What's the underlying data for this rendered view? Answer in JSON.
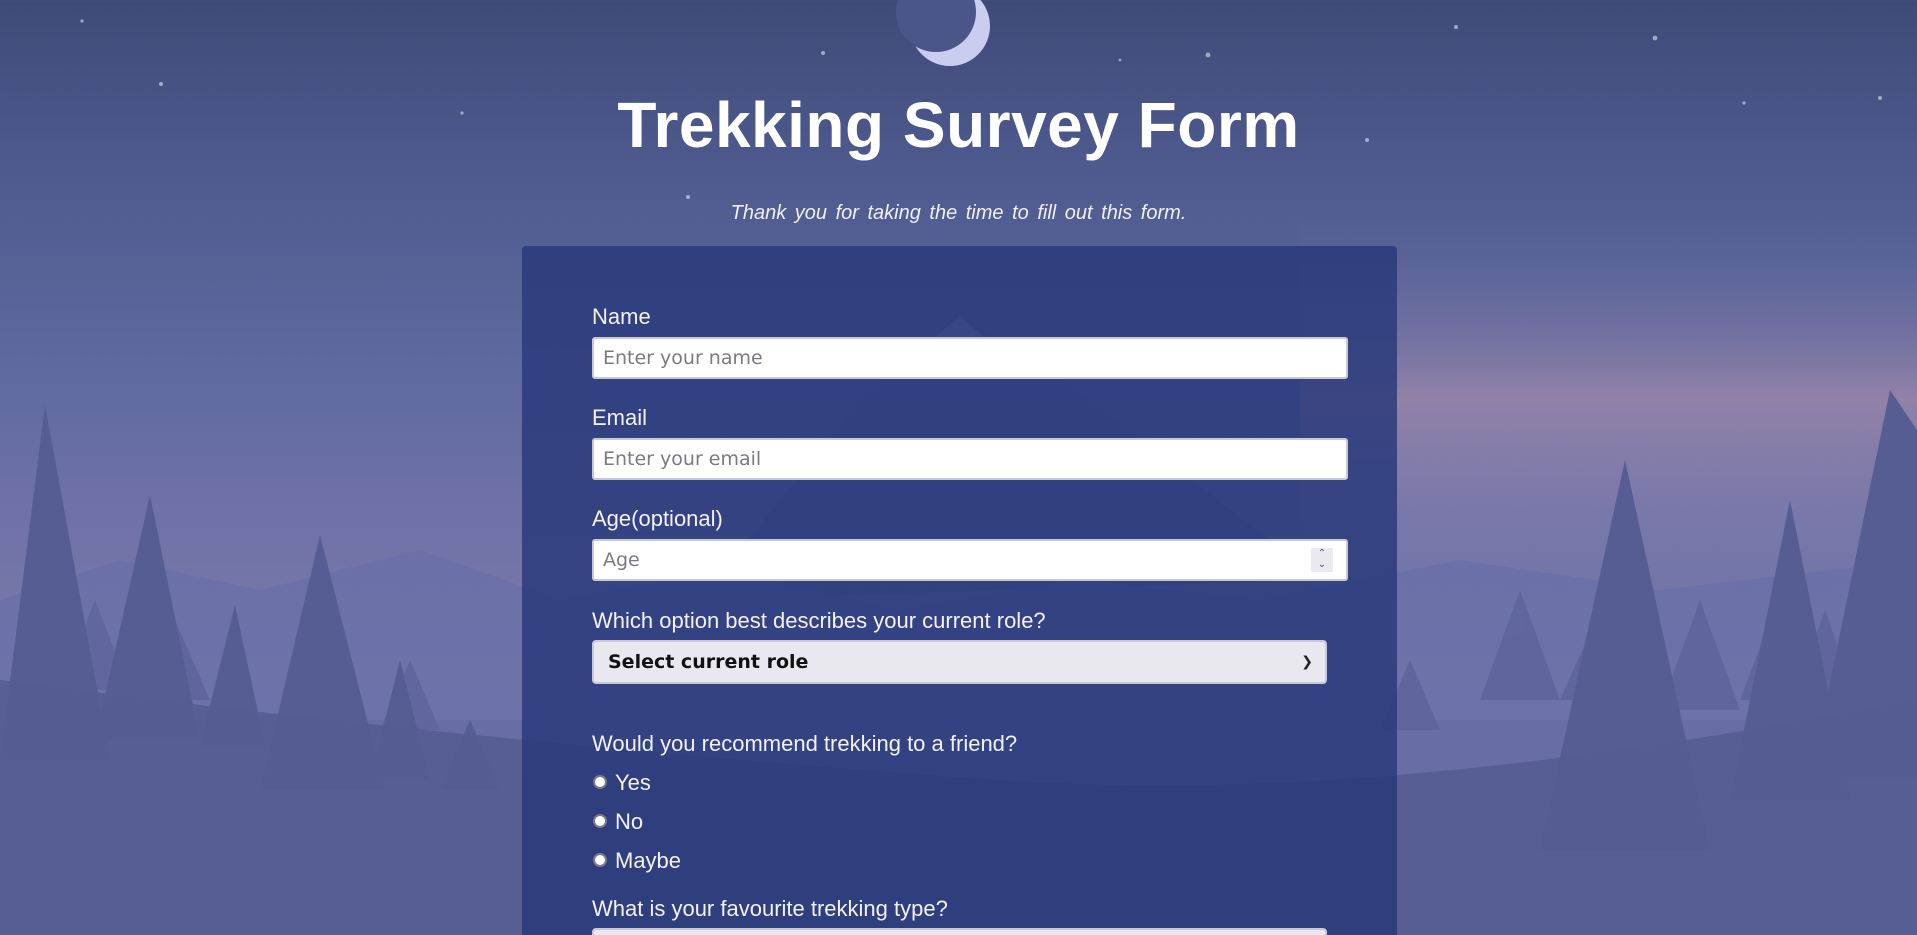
{
  "header": {
    "title": "Trekking Survey Form",
    "subtitle": "Thank you for taking the time to fill out this form."
  },
  "form": {
    "name": {
      "label": "Name",
      "placeholder": "Enter your name"
    },
    "email": {
      "label": "Email",
      "placeholder": "Enter your email"
    },
    "age": {
      "label": "Age(optional)",
      "placeholder": "Age"
    },
    "role": {
      "label": "Which option best describes your current role?",
      "selected": "Select current role"
    },
    "recommend": {
      "label": "Would you recommend trekking to a friend?",
      "options": [
        "Yes",
        "No",
        "Maybe"
      ]
    },
    "favourite": {
      "label": "What is your favourite trekking type?"
    }
  },
  "colors": {
    "card_background": "#27387a",
    "sky_top": "#3f4a78",
    "sky_glow": "#c79aa8"
  },
  "icons": {
    "moon": "crescent-moon-icon",
    "select": "chevron-down-icon",
    "spinner": "number-spinner-icon"
  }
}
